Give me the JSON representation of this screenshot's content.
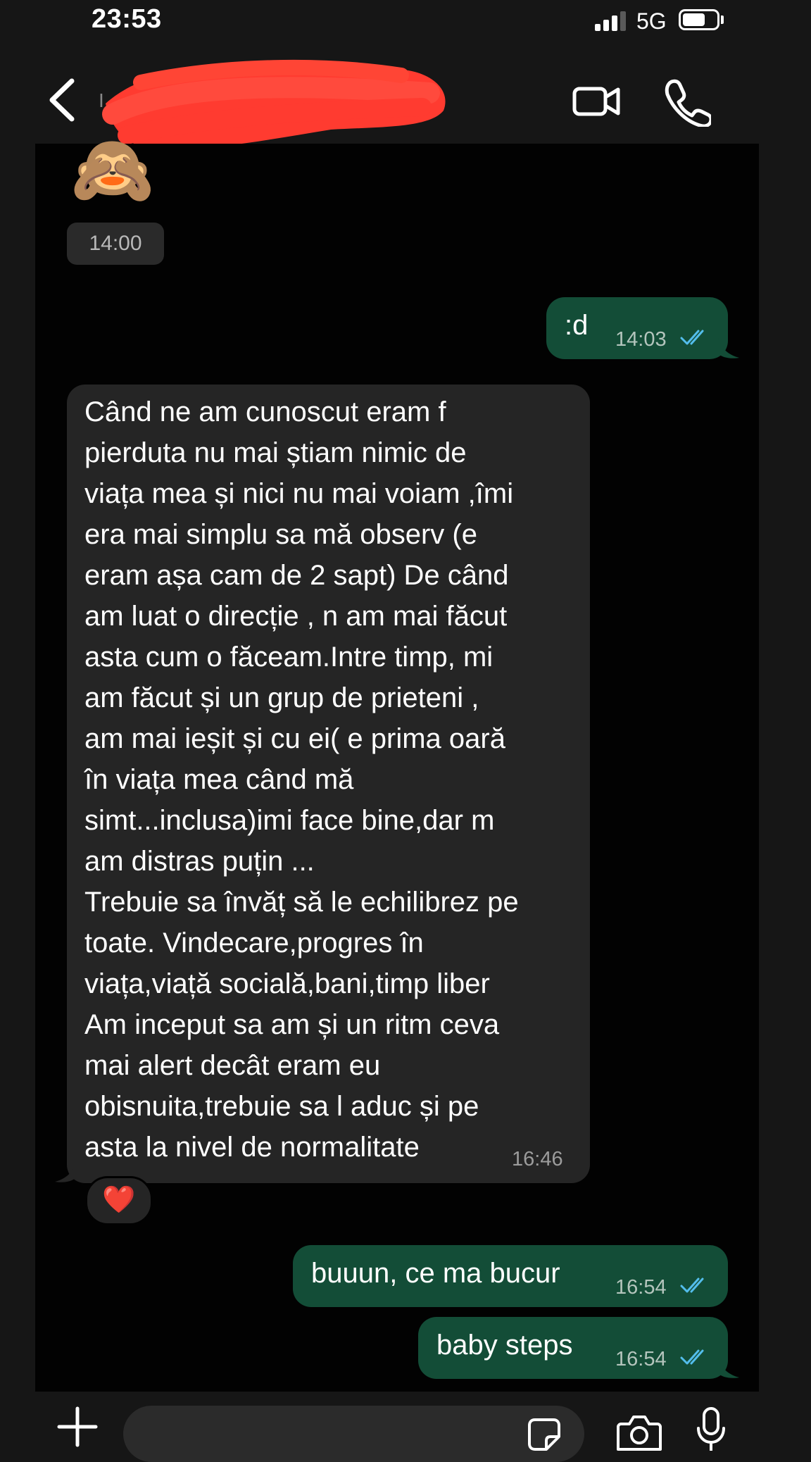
{
  "status_bar": {
    "time": "23:53",
    "network": "5G",
    "signal_bars_active": 3,
    "signal_bars_total": 4,
    "battery_level": 0.6
  },
  "header": {
    "contact_name": "I",
    "icons": {
      "back": "chevron-left-icon",
      "video": "video-camera-icon",
      "call": "phone-icon"
    }
  },
  "chat": {
    "sticker_emoji": "🙈",
    "sticker_time": "14:00",
    "messages": [
      {
        "direction": "out",
        "text": ":d",
        "time": "14:03",
        "status": "read"
      },
      {
        "direction": "in",
        "lines": [
          "Când ne am cunoscut eram f",
          "pierduta nu mai știam nimic de",
          "viața mea și nici nu mai voiam ,îmi",
          "era mai simplu sa mă observ (e",
          "eram așa cam de 2 sapt) De când",
          "am luat o direcție , n am mai făcut",
          "asta cum o făceam.Intre timp, mi",
          "am făcut și un grup de prieteni ,",
          "am mai ieșit și cu ei( e prima oară",
          "în viața mea când mă",
          "simt...inclusa)imi face bine,dar m",
          "am distras puțin ...",
          "Trebuie sa învăț să le echilibrez pe",
          "toate. Vindecare,progres în",
          "viața,viață socială,bani,timp liber",
          "Am inceput sa am și un ritm ceva",
          "mai alert decât eram eu",
          "obisnuita,trebuie sa l aduc și pe",
          "asta la nivel de normalitate"
        ],
        "time": "16:46",
        "reaction": "❤️"
      },
      {
        "direction": "out",
        "text": "buuun, ce ma bucur",
        "time": "16:54",
        "status": "read"
      },
      {
        "direction": "out",
        "text": "baby steps",
        "time": "16:54",
        "status": "read"
      }
    ]
  },
  "input_bar": {
    "placeholder": "",
    "icons": {
      "plus": "plus-icon",
      "sticker": "sticker-icon",
      "camera": "camera-icon",
      "mic": "microphone-icon"
    }
  },
  "colors": {
    "background": "#020202",
    "bars": "#161616",
    "outgoing_bubble": "#134d37",
    "incoming_bubble": "#252525",
    "read_ticks": "#53bdeb",
    "redaction": "#ff3b30"
  }
}
